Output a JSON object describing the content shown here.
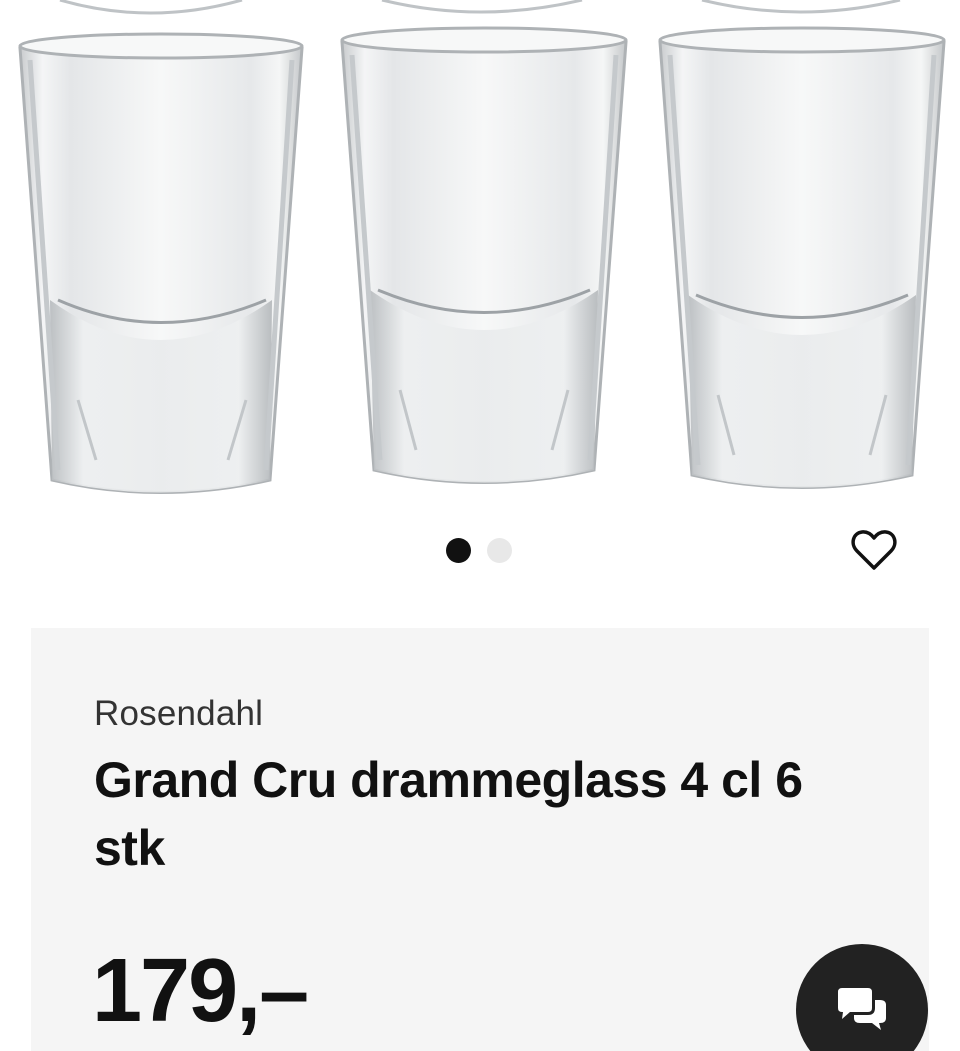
{
  "product": {
    "brand": "Rosendahl",
    "title": "Grand Cru drammeglass 4 cl 6 stk",
    "price": "179,–",
    "image_alt": "Grand Cru drammeglass"
  },
  "gallery": {
    "slide_count": 2,
    "active_slide": 1
  },
  "icons": {
    "favorite": "heart-outline-icon",
    "chat": "chat-bubbles-icon"
  },
  "colors": {
    "card_background": "#f5f5f5",
    "text": "#111111",
    "dot_active": "#111111",
    "dot_inactive": "#e8e8e8",
    "chat_button": "#222222"
  }
}
